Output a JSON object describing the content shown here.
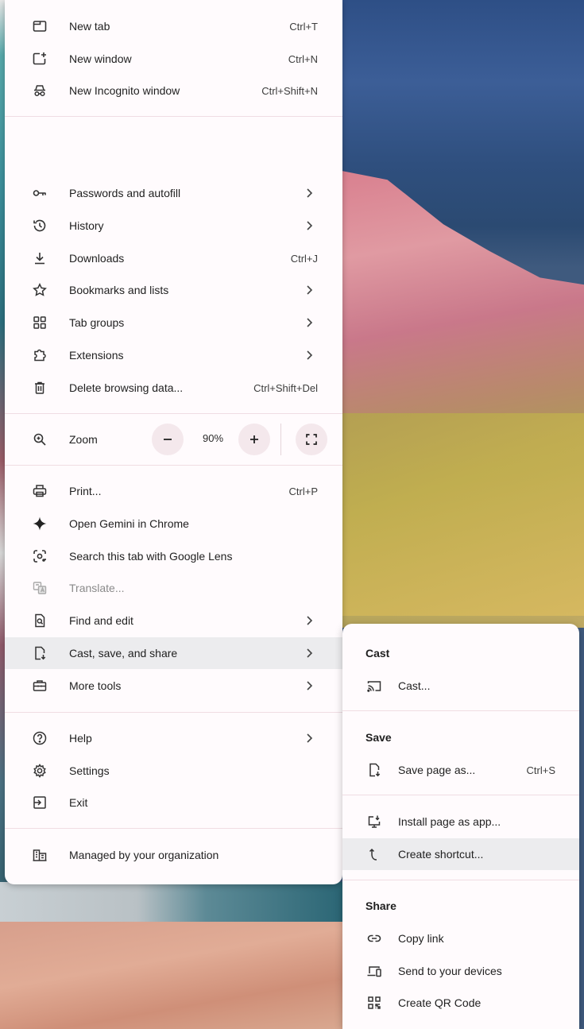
{
  "colors": {
    "menu_bg": "#fffbfd",
    "highlight": "#ececee",
    "zoom_btn": "#f4e8ec"
  },
  "menu": {
    "top_items": [
      {
        "label": "New tab",
        "shortcut": "Ctrl+T",
        "icon": "new-tab-icon"
      },
      {
        "label": "New window",
        "shortcut": "Ctrl+N",
        "icon": "new-window-icon"
      },
      {
        "label": "New Incognito window",
        "shortcut": "Ctrl+Shift+N",
        "icon": "incognito-icon"
      }
    ],
    "mid_items": [
      {
        "label": "Passwords and autofill",
        "icon": "key-icon",
        "submenu": true
      },
      {
        "label": "History",
        "icon": "history-icon",
        "submenu": true
      },
      {
        "label": "Downloads",
        "shortcut": "Ctrl+J",
        "icon": "download-icon"
      },
      {
        "label": "Bookmarks and lists",
        "icon": "star-icon",
        "submenu": true
      },
      {
        "label": "Tab groups",
        "icon": "tab-groups-icon",
        "submenu": true
      },
      {
        "label": "Extensions",
        "icon": "puzzle-icon",
        "submenu": true
      },
      {
        "label": "Delete browsing data...",
        "shortcut": "Ctrl+Shift+Del",
        "icon": "trash-icon"
      }
    ],
    "zoom": {
      "label": "Zoom",
      "value": "90%",
      "minus": "−",
      "plus": "+"
    },
    "tool_items": [
      {
        "label": "Print...",
        "shortcut": "Ctrl+P",
        "icon": "printer-icon"
      },
      {
        "label": "Open Gemini in Chrome",
        "icon": "gemini-sparkle-icon"
      },
      {
        "label": "Search this tab with Google Lens",
        "icon": "lens-icon"
      },
      {
        "label": "Translate...",
        "icon": "translate-icon",
        "disabled": true
      },
      {
        "label": "Find and edit",
        "icon": "find-page-icon",
        "submenu": true
      },
      {
        "label": "Cast, save, and share",
        "icon": "cast-save-share-icon",
        "submenu": true,
        "highlighted": true
      },
      {
        "label": "More tools",
        "icon": "toolbox-icon",
        "submenu": true
      }
    ],
    "help_items": [
      {
        "label": "Help",
        "icon": "help-icon",
        "submenu": true
      },
      {
        "label": "Settings",
        "icon": "gear-icon"
      },
      {
        "label": "Exit",
        "icon": "exit-icon"
      }
    ],
    "managed": {
      "label": "Managed by your organization",
      "icon": "building-icon"
    }
  },
  "submenu": {
    "cast_heading": "Cast",
    "cast_item": "Cast...",
    "save_heading": "Save",
    "save_page": {
      "label": "Save page as...",
      "shortcut": "Ctrl+S"
    },
    "install_app": "Install page as app...",
    "create_shortcut": "Create shortcut...",
    "share_heading": "Share",
    "copy_link": "Copy link",
    "send_devices": "Send to your devices",
    "qr_code": "Create QR Code"
  }
}
